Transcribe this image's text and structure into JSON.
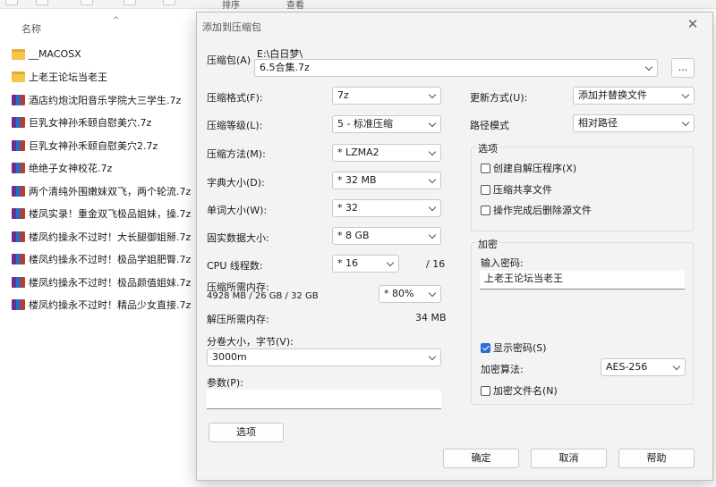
{
  "explorer": {
    "column_name": "名称",
    "files": [
      {
        "name": "__MACOSX",
        "type": "folder"
      },
      {
        "name": "上老王论坛当老王",
        "type": "folder"
      },
      {
        "name": "酒店约炮沈阳音乐学院大三学生.7z",
        "type": "archive"
      },
      {
        "name": "巨乳女神孙禾颐自慰美穴.7z",
        "type": "archive"
      },
      {
        "name": "巨乳女神孙禾颐自慰美穴2.7z",
        "type": "archive"
      },
      {
        "name": "绝绝子女神校花.7z",
        "type": "archive"
      },
      {
        "name": "两个清纯外围嫩妹双飞，两个轮流.7z",
        "type": "archive"
      },
      {
        "name": "楼凤实录！重金双飞极品姐妹，操.7z",
        "type": "archive"
      },
      {
        "name": "楼凤约操永不过时！大长腿御姐掰.7z",
        "type": "archive"
      },
      {
        "name": "楼凤约操永不过时！极品学姐肥臀.7z",
        "type": "archive"
      },
      {
        "name": "楼凤约操永不过时！极品颜值姐妹.7z",
        "type": "archive"
      },
      {
        "name": "楼凤约操永不过时！精品少女直接.7z",
        "type": "archive"
      }
    ]
  },
  "dialog": {
    "title": "添加到压缩包",
    "archive_label": "压缩包(A)",
    "archive_path": "E:\\白日梦\\",
    "archive_name": "6.5合集.7z",
    "browse_label": "...",
    "format_label": "压缩格式(F):",
    "format_value": "7z",
    "level_label": "压缩等级(L):",
    "level_value": "5 - 标准压缩",
    "method_label": "压缩方法(M):",
    "method_value": "* LZMA2",
    "dict_label": "字典大小(D):",
    "dict_value": "* 32 MB",
    "word_label": "单词大小(W):",
    "word_value": "* 32",
    "solid_label": "固实数据大小:",
    "solid_value": "* 8 GB",
    "threads_label": "CPU 线程数:",
    "threads_value": "* 16",
    "threads_max": "/ 16",
    "mem_comp_label": "压缩所需内存:",
    "mem_comp_detail": "4928 MB / 26 GB / 32 GB",
    "mem_comp_pct": "* 80%",
    "mem_decomp_label": "解压所需内存:",
    "mem_decomp_value": "34 MB",
    "volume_label": "分卷大小，字节(V):",
    "volume_value": "3000m",
    "params_label": "参数(P):",
    "params_value": "",
    "options_button": "选项",
    "update_label": "更新方式(U):",
    "update_value": "添加并替换文件",
    "path_label": "路径模式",
    "path_value": "相对路径",
    "options_group": "选项",
    "opt_sfx": "创建自解压程序(X)",
    "opt_shared": "压缩共享文件",
    "opt_delete": "操作完成后删除源文件",
    "enc_group": "加密",
    "pwd_label": "输入密码:",
    "pwd_value": "上老王论坛当老王",
    "show_pwd": "显示密码(S)",
    "enc_method_label": "加密算法:",
    "enc_method_value": "AES-256",
    "enc_names": "加密文件名(N)",
    "ok": "确定",
    "cancel": "取消",
    "help": "帮助"
  },
  "toolbar": {
    "sort_label": "排序",
    "view_label": "查看"
  }
}
